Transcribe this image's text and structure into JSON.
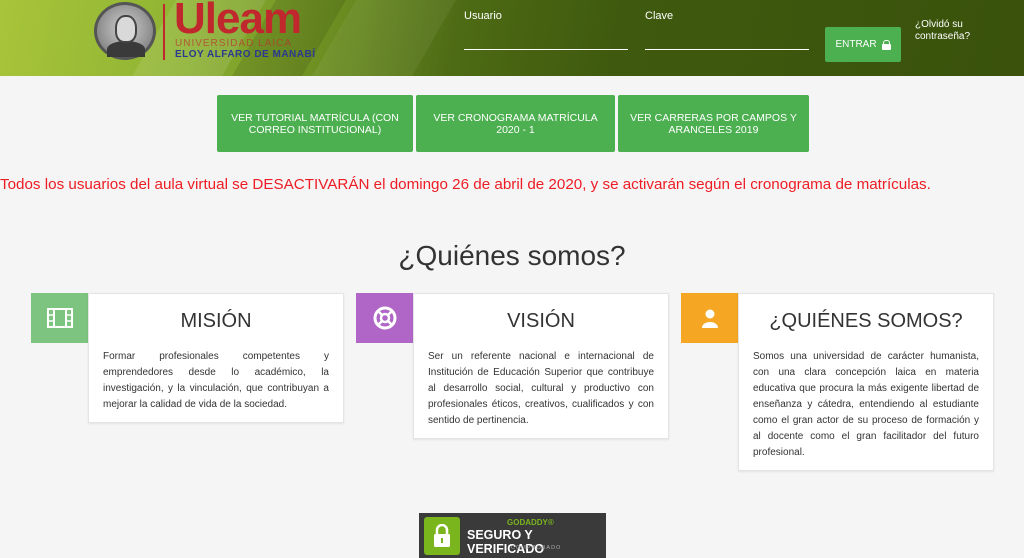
{
  "header": {
    "logo": {
      "name": "Uleam",
      "line1": "UNIVERSIDAD LAICA",
      "line2": "ELOY ALFARO DE MANABÍ"
    },
    "username_label": "Usuario",
    "username_value": "",
    "password_label": "Clave",
    "password_value": "",
    "login_button": "ENTRAR",
    "forgot_password": "¿Olvidó su contraseña?"
  },
  "actions": [
    {
      "label": "VER TUTORIAL MATRÍCULA (CON CORREO INSTITUCIONAL)"
    },
    {
      "label": "VER CRONOGRAMA MATRÍCULA 2020 - 1"
    },
    {
      "label": "VER CARRERAS POR CAMPOS Y ARANCELES 2019"
    }
  ],
  "notice": "Todos los usuarios del aula virtual se DESACTIVARÁN el domingo 26 de abril de 2020, y se activarán según el cronograma de matrículas.",
  "about": {
    "title": "¿Quiénes somos?",
    "cards": [
      {
        "title": "MISIÓN",
        "icon": "film-icon",
        "icon_color": "#7cc47f",
        "text": "Formar profesionales competentes y emprendedores desde lo académico, la investigación, y la vinculación, que contribuyan a mejorar la calidad de vida de la sociedad."
      },
      {
        "title": "VISIÓN",
        "icon": "lifebuoy-icon",
        "icon_color": "#b066c7",
        "text": "Ser un referente nacional e internacional de Institución de Educación Superior que contribuye al desarrollo social, cultural y productivo con profesionales éticos, creativos, cualificados y con sentido de pertinencia."
      },
      {
        "title": "¿QUIÉNES SOMOS?",
        "icon": "user-icon",
        "icon_color": "#f5a623",
        "text": "Somos una universidad de carácter humanista, con una clara concepción laica en materia educativa que procura la más exigente libertad de enseñanza y cátedra, entendiendo al estudiante como el gran actor de su proceso de formación y al docente como el gran facilitador del futuro profesional."
      }
    ]
  },
  "badge": {
    "brand": "GODADDY®",
    "title": "SEGURO Y VERIFICADO",
    "sub": "COMPROBADO"
  }
}
